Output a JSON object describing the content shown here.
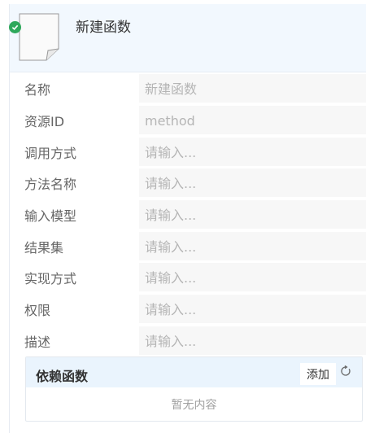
{
  "header": {
    "title": "新建函数",
    "status_icon": "check-icon",
    "doc_icon": "document-icon",
    "status_color": "#2ea85b"
  },
  "fields": [
    {
      "label": "名称",
      "value": "新建函数"
    },
    {
      "label": "资源ID",
      "value": "method"
    },
    {
      "label": "调用方式",
      "value": "请输入..."
    },
    {
      "label": "方法名称",
      "value": "请输入..."
    },
    {
      "label": "输入模型",
      "value": "请输入..."
    },
    {
      "label": "结果集",
      "value": "请输入..."
    },
    {
      "label": "实现方式",
      "value": "请输入..."
    },
    {
      "label": "权限",
      "value": "请输入..."
    },
    {
      "label": "描述",
      "value": "请输入..."
    }
  ],
  "dependencies": {
    "title": "依赖函数",
    "add_label": "添加",
    "refresh_icon": "refresh-icon",
    "empty_text": "暂无内容"
  }
}
